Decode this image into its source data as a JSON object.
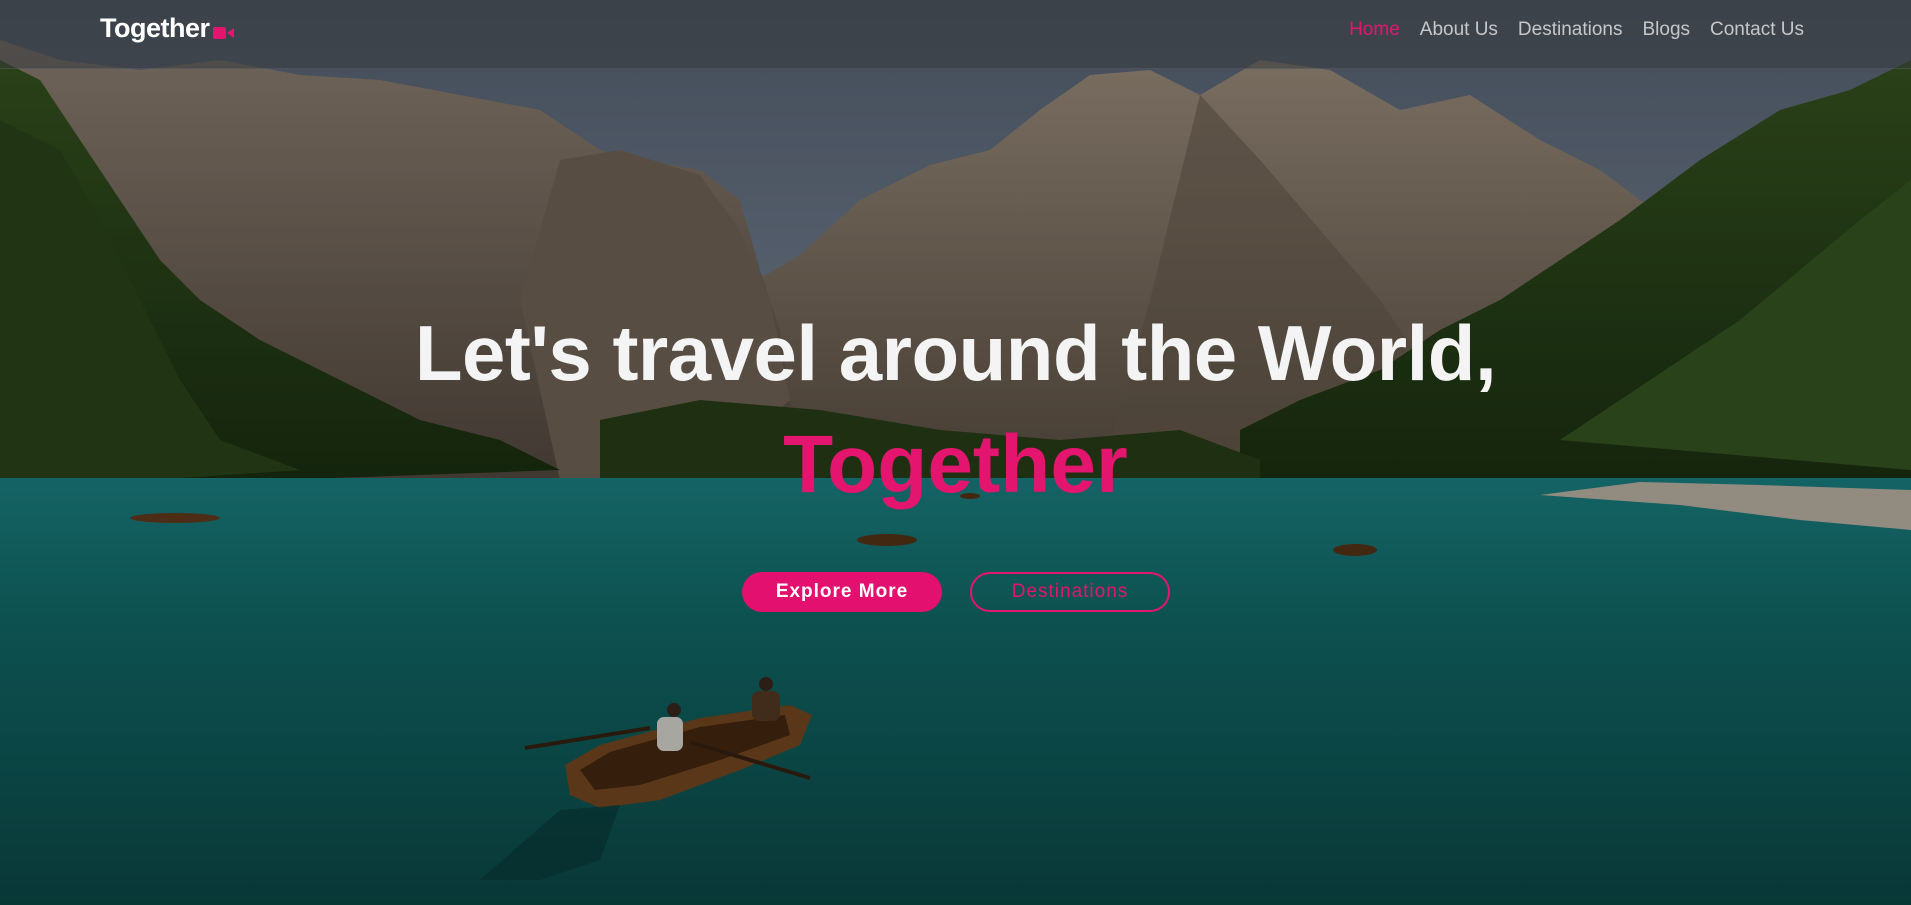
{
  "brand": {
    "name": "Together",
    "accent_color": "#e3156e",
    "icon": "video-camera-icon"
  },
  "nav": {
    "items": [
      {
        "label": "Home",
        "active": true
      },
      {
        "label": "About Us",
        "active": false
      },
      {
        "label": "Destinations",
        "active": false
      },
      {
        "label": "Blogs",
        "active": false
      },
      {
        "label": "Contact Us",
        "active": false
      }
    ]
  },
  "hero": {
    "headline": "Let's travel around the World,",
    "headline_accent": "Together",
    "primary_button": "Explore More",
    "secondary_button": "Destinations",
    "background": "mountain-lake-with-rowboats"
  }
}
